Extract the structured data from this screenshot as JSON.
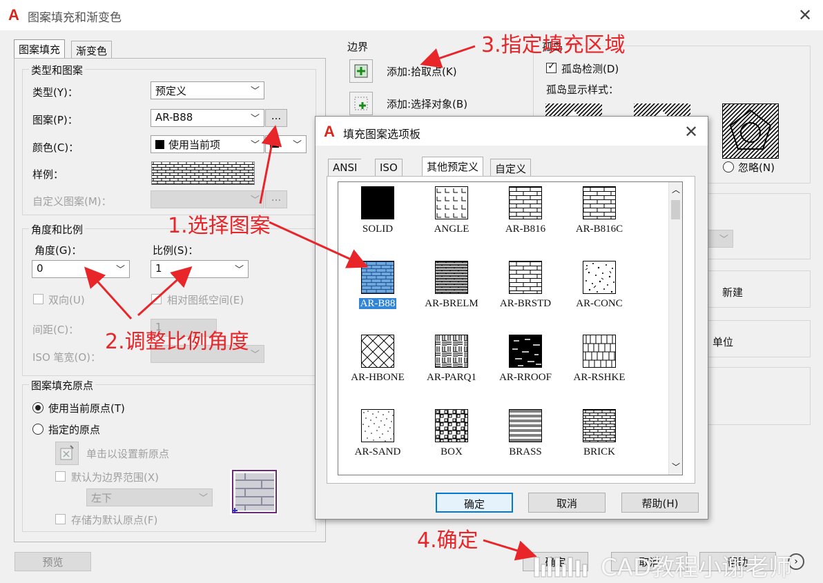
{
  "window": {
    "title": "图案填充和渐变色"
  },
  "tabs": [
    "图案填充",
    "渐变色"
  ],
  "type_pattern": {
    "legend": "类型和图案",
    "type_label": "类型(Y)：",
    "type_value": "预定义",
    "pattern_label": "图案(P)：",
    "pattern_value": "AR-B88",
    "pattern_browse": "...",
    "color_label": "颜色(C)：",
    "color_value": "使用当前项",
    "sample_label": "样例：",
    "custom_label": "自定义图案(M)：",
    "custom_browse": "..."
  },
  "angle_scale": {
    "legend": "角度和比例",
    "angle_label": "角度(G)：",
    "angle_value": "0",
    "scale_label": "比例(S)：",
    "scale_value": "1",
    "double_label": "双向(U)",
    "relative_label": "相对图纸空间(E)",
    "spacing_label": "间距(C)：",
    "spacing_value": "1",
    "iso_label": "ISO 笔宽(O)："
  },
  "origin": {
    "legend": "图案填充原点",
    "use_current": "使用当前原点(T)",
    "specified": "指定的原点",
    "click_set": "单击以设置新原点",
    "default_bounds": "默认为边界范围(X)",
    "position_value": "左下",
    "store_default": "存储为默认原点(F)"
  },
  "boundary": {
    "legend": "边界",
    "add_pick": "添加:拾取点(K)",
    "add_select": "添加:选择对象(B)"
  },
  "islands": {
    "legend": "孤岛",
    "detect": "孤岛检测(D)",
    "style_label": "孤岛显示样式：",
    "ignore": "忽略(N)"
  },
  "right_buttons": {
    "new": "新建",
    "unit": "单位"
  },
  "bottom": {
    "preview": "预览",
    "ok": "确定",
    "cancel": "取消",
    "help": "帮助"
  },
  "palette": {
    "title": "填充图案选项板",
    "tabs": [
      "ANSI",
      "ISO",
      "其他预定义",
      "自定义"
    ],
    "patterns": [
      "SOLID",
      "ANGLE",
      "AR-B816",
      "AR-B816C",
      "AR-B88",
      "AR-BRELM",
      "AR-BRSTD",
      "AR-CONC",
      "AR-HBONE",
      "AR-PARQ1",
      "AR-RROOF",
      "AR-RSHKE",
      "AR-SAND",
      "BOX",
      "BRASS",
      "BRICK"
    ],
    "selected": "AR-B88",
    "ok": "确定",
    "cancel": "取消",
    "help": "帮助(H)"
  },
  "annotations": {
    "a1": "1.选择图案",
    "a2": "2.调整比例角度",
    "a3": "3.指定填充区域",
    "a4": "4.确定"
  },
  "watermark": "CAD教程小谢老师",
  "colors": {
    "accent_red": "#e8262a",
    "selection_blue": "#3385d6",
    "logo_red": "#d8261c"
  }
}
